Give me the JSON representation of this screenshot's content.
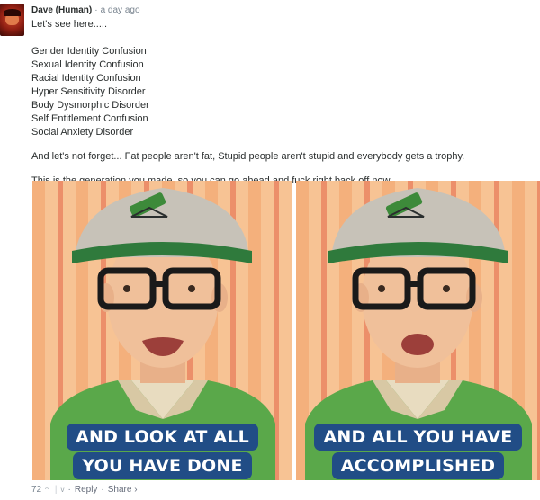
{
  "comment": {
    "author": "Dave (Human)",
    "separator": "·",
    "time": "a day ago",
    "intro": "Let's see here.....",
    "disorders": [
      "Gender Identity Confusion",
      "Sexual Identity Confusion",
      "Racial Identity Confusion",
      "Hyper Sensitivity Disorder",
      "Body Dysmorphic Disorder",
      "Self Entitlement Confusion",
      "Social Anxiety Disorder"
    ],
    "paragraph1": "And let's not forget... Fat people aren't fat, Stupid people aren't stupid and everybody gets a trophy.",
    "paragraph2": "This is the generation you made, so you can go ahead and fuck right back off now."
  },
  "images": {
    "left": {
      "caption_line1": "AND LOOK AT ALL",
      "caption_line2": "YOU HAVE DONE"
    },
    "right": {
      "caption_line1": "AND ALL YOU HAVE",
      "caption_line2": "ACCOMPLISHED"
    }
  },
  "footer": {
    "votes": "72",
    "upvote_icon": "^",
    "downvote_icon": "v",
    "bar": "|",
    "dot": "·",
    "reply": "Reply",
    "share": "Share ›"
  },
  "colors": {
    "caption_bg": "#214d86",
    "text": "#2a2e2e",
    "muted": "#7a8590"
  }
}
